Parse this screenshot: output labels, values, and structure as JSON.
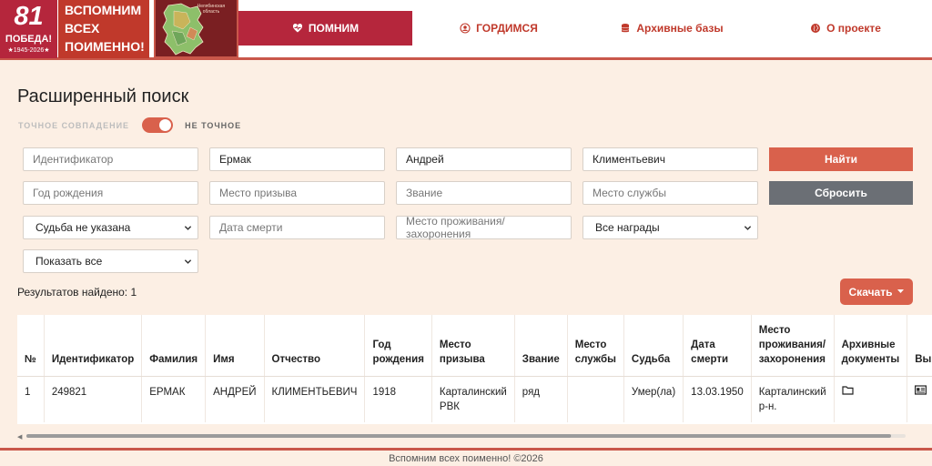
{
  "header": {
    "badge_number": "81",
    "badge_text": "ПОБЕДА!",
    "badge_years": "★1945-2026★",
    "slogan": [
      "ВСПОМНИМ",
      "ВСЕХ",
      "ПОИМЕННО!"
    ],
    "map_caption": "Челябинская область",
    "nav": [
      {
        "label": "ПОМНИМ",
        "icon": "heart-pulse-icon",
        "active": true
      },
      {
        "label": "ГОРДИМСЯ",
        "icon": "user-circle-icon",
        "active": false
      },
      {
        "label": "Архивные базы",
        "icon": "database-icon",
        "active": false
      },
      {
        "label": "О проекте",
        "icon": "globe-icon",
        "active": false
      }
    ]
  },
  "search": {
    "title": "Расширенный поиск",
    "toggle_off_label": "ТОЧНОЕ СОВПАДЕНИЕ",
    "toggle_on_label": "НЕ ТОЧНОЕ",
    "toggle_state": "не точное",
    "fields": {
      "id": {
        "placeholder": "Идентификатор",
        "value": ""
      },
      "surname": {
        "placeholder": "Фамилия",
        "value": "Ермак"
      },
      "name": {
        "placeholder": "Имя",
        "value": "Андрей"
      },
      "patronymic": {
        "placeholder": "Отчество",
        "value": "Климентьевич"
      },
      "birth_year": {
        "placeholder": "Год рождения",
        "value": ""
      },
      "draft_place": {
        "placeholder": "Место призыва",
        "value": ""
      },
      "rank": {
        "placeholder": "Звание",
        "value": ""
      },
      "service_place": {
        "placeholder": "Место службы",
        "value": ""
      },
      "fate": {
        "selected": "Судьба не указана"
      },
      "death_date": {
        "placeholder": "Дата смерти",
        "value": ""
      },
      "residence": {
        "placeholder": "Место проживания/захоронения",
        "value": ""
      },
      "awards": {
        "selected": "Все награды"
      },
      "show": {
        "selected": "Показать все"
      }
    },
    "find_label": "Найти",
    "reset_label": "Сбросить",
    "download_label": "Скачать",
    "results_text": "Результатов найдено: 1"
  },
  "table": {
    "columns": [
      "№",
      "Идентификатор",
      "Фамилия",
      "Имя",
      "Отчество",
      "Год рождения",
      "Место призыва",
      "Звание",
      "Место службы",
      "Судьба",
      "Дата смерти",
      "Место проживания/ захоронения",
      "Архивные документы",
      "Вып"
    ],
    "rows": [
      {
        "num": "1",
        "id": "249821",
        "surname": "ЕРМАК",
        "name": "АНДРЕЙ",
        "patronymic": "КЛИМЕНТЬЕВИЧ",
        "birth_year": "1918",
        "draft_place": "Карталинский РВК",
        "rank": "ряд",
        "service_place": "",
        "fate": "Умер(ла)",
        "death_date": "13.03.1950",
        "residence": "Карталинский р-н.",
        "archive_icon": "folder-icon",
        "extract_icon": "id-card-icon"
      }
    ]
  },
  "footer": {
    "text": "Вспомним всех поименно! ©2026"
  },
  "colors": {
    "accent": "#d9614c",
    "brand": "#b5263c",
    "background": "#fcefe4",
    "reset": "#6b6f75"
  }
}
